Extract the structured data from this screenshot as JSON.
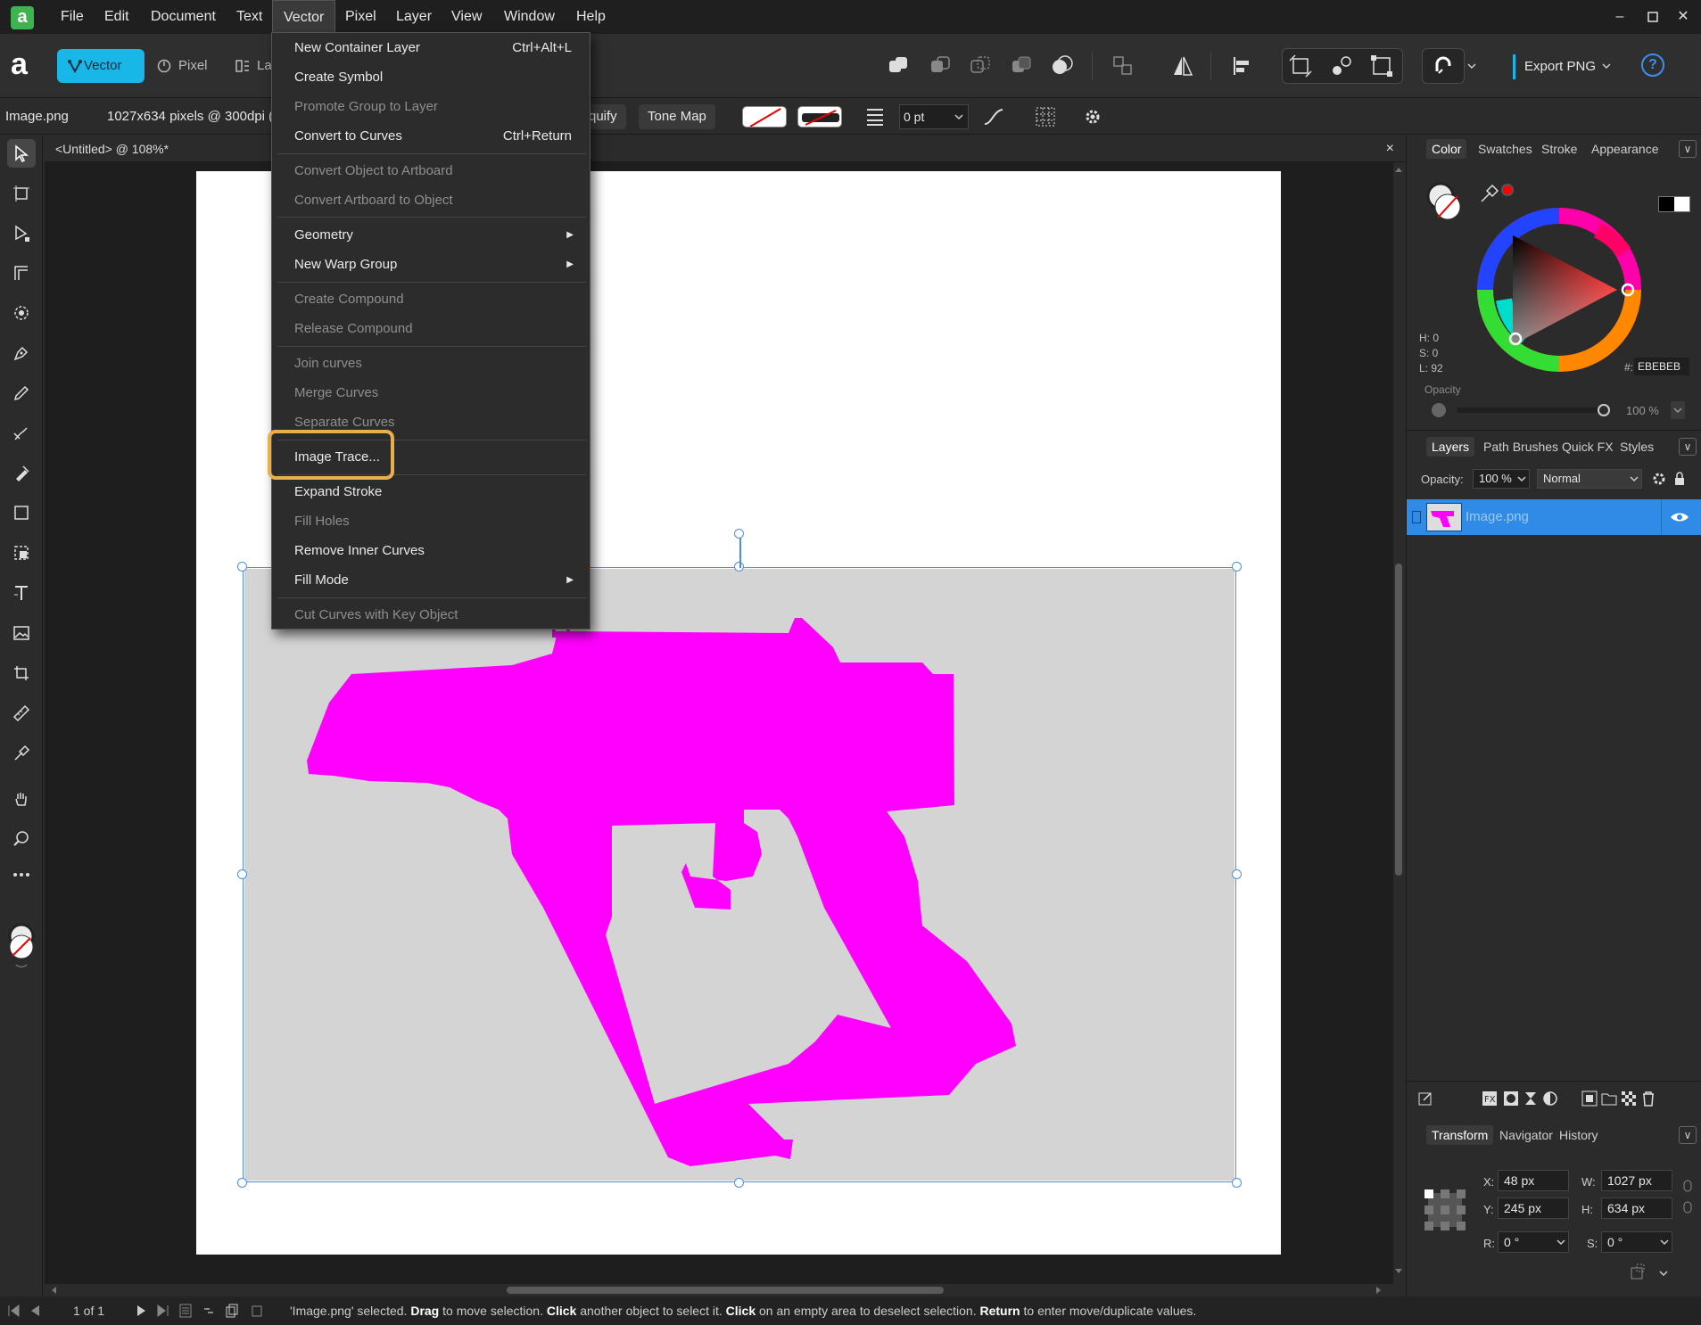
{
  "menubar": {
    "items": [
      "File",
      "Edit",
      "Document",
      "Text",
      "Vector",
      "Pixel",
      "Layer",
      "View",
      "Window",
      "Help"
    ],
    "active": "Vector"
  },
  "toolbar": {
    "personas": {
      "vector": "Vector",
      "pixel": "Pixel",
      "layout": "La"
    },
    "export_label": "Export PNG",
    "help_label": "?"
  },
  "context": {
    "filename": "Image.png",
    "dimensions": "1027x634 pixels @ 300dpi (",
    "liquify_label": "quify",
    "tonemap_label": "Tone Map",
    "stroke_size": "0 pt"
  },
  "document": {
    "tab_title": "<Untitled> @ 108%*",
    "close_glyph": "×"
  },
  "vector_menu": {
    "items": [
      {
        "label": "New Container Layer",
        "shortcut": "Ctrl+Alt+L",
        "enabled": true
      },
      {
        "label": "Create Symbol",
        "shortcut": "",
        "enabled": true
      },
      {
        "label": "Promote Group to Layer",
        "shortcut": "",
        "enabled": false
      },
      {
        "label": "Convert to Curves",
        "shortcut": "Ctrl+Return",
        "enabled": true
      },
      {
        "label": "Convert Object to Artboard",
        "shortcut": "",
        "enabled": false
      },
      {
        "label": "Convert Artboard to Object",
        "shortcut": "",
        "enabled": false
      },
      {
        "label": "Geometry",
        "submenu": true,
        "enabled": true
      },
      {
        "label": "New Warp Group",
        "submenu": true,
        "enabled": true
      },
      {
        "label": "Create Compound",
        "shortcut": "",
        "enabled": false
      },
      {
        "label": "Release Compound",
        "shortcut": "",
        "enabled": false
      },
      {
        "label": "Join curves",
        "shortcut": "",
        "enabled": false
      },
      {
        "label": "Merge Curves",
        "shortcut": "",
        "enabled": false
      },
      {
        "label": "Separate Curves",
        "shortcut": "",
        "enabled": false
      },
      {
        "label": "Image Trace...",
        "shortcut": "",
        "enabled": true,
        "highlighted": true
      },
      {
        "label": "Expand Stroke",
        "shortcut": "",
        "enabled": true
      },
      {
        "label": "Fill Holes",
        "shortcut": "",
        "enabled": false
      },
      {
        "label": "Remove Inner Curves",
        "shortcut": "",
        "enabled": true
      },
      {
        "label": "Fill Mode",
        "submenu": true,
        "enabled": true
      },
      {
        "label": "Cut Curves with Key Object",
        "shortcut": "",
        "enabled": false
      }
    ],
    "highlight_color": "#e8b04b"
  },
  "color_panel": {
    "tabs": [
      "Color",
      "Swatches",
      "Stroke",
      "Appearance"
    ],
    "h": "H: 0",
    "s": "S: 0",
    "l": "L: 92",
    "hex_label": "#:",
    "hex": "EBEBEB",
    "opacity_label": "Opacity",
    "opacity_value": "100 %"
  },
  "layers_panel": {
    "tabs": [
      "Layers",
      "Path Brushes",
      "Quick FX",
      "Styles"
    ],
    "opacity_label": "Opacity:",
    "opacity_value": "100 %",
    "blend_mode": "Normal",
    "layer_name": "Image.png"
  },
  "transform_panel": {
    "tabs": [
      "Transform",
      "Navigator",
      "History"
    ],
    "x_label": "X:",
    "x": "48 px",
    "y_label": "Y:",
    "y": "245 px",
    "w_label": "W:",
    "w": "1027 px",
    "h_label": "H:",
    "h": "634 px",
    "r_label": "R:",
    "r": "0 °",
    "s_label": "S:",
    "s": "0 °"
  },
  "status": {
    "page": "1 of 1",
    "msg_1": "'Image.png' selected. ",
    "msg_drag": "Drag",
    "msg_2": " to move selection. ",
    "msg_click": "Click",
    "msg_3": " another object to select it. ",
    "msg_click2": "Click",
    "msg_4": " on an empty area to deselect selection. ",
    "msg_return": "Return",
    "msg_5": " to enter move/duplicate values."
  },
  "colors": {
    "accent": "#19b6e8",
    "selection": "#4a90e2",
    "layer_selected": "#2f8be6",
    "gun_fill": "#ff00ff",
    "image_bg": "#d4d4d4"
  }
}
